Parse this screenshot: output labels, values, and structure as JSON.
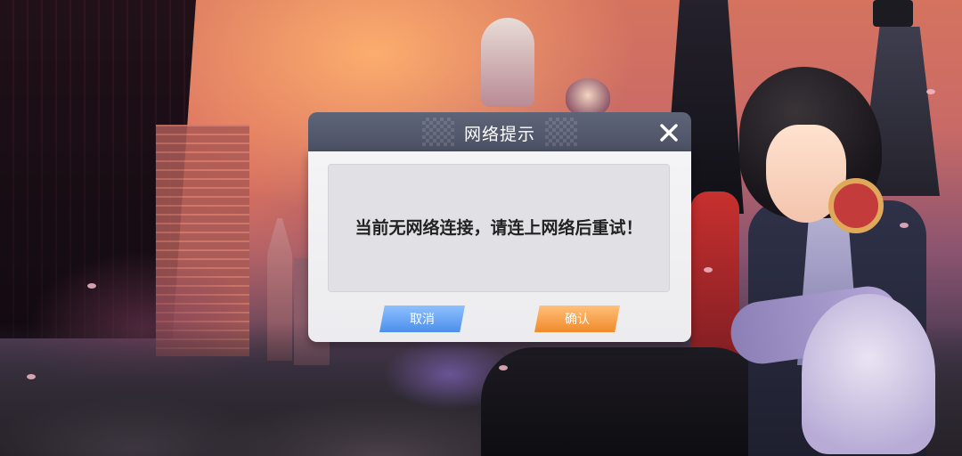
{
  "dialog": {
    "title": "网络提示",
    "message": "当前无网络连接，请连上网络后重试！",
    "cancel_label": "取消",
    "confirm_label": "确认",
    "close_icon": "close-icon"
  },
  "colors": {
    "header": "#53596c",
    "body": "#f1f1f3",
    "message_box": "#e1e1e5",
    "cancel_button": "#5a9cf0",
    "confirm_button": "#f4962f"
  }
}
